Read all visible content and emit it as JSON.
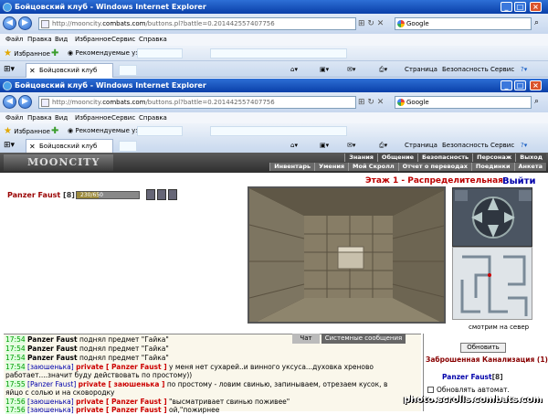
{
  "browser": {
    "title": "Бойцовский клуб - Windows Internet Explorer",
    "url_prefix": "http://mooncity.",
    "url_domain": "combats.com",
    "url_rest": "/buttons.pl?battle=0.201442557407756",
    "search_placeholder": "Google",
    "menu": [
      "Файл",
      "Правка",
      "Вид",
      "Избранное",
      "Сервис",
      "Справка"
    ],
    "favorites_label": "Избранное",
    "suggested_sites": "Рекомендуемые узлы",
    "tab_title": "Бойцовский клуб",
    "commands": {
      "page": "Страница",
      "security": "Безопасность",
      "tools": "Сервис"
    }
  },
  "game": {
    "logo": "MOONCITY",
    "menu_top": [
      "Знания",
      "Общение",
      "Безопасность",
      "Персонаж",
      "Выход"
    ],
    "menu_bottom": [
      "Инвентарь",
      "Умения",
      "Мой Скролл",
      "Отчет о переводах",
      "Поединки",
      "Анкета"
    ],
    "character": {
      "name": "Panzer Faust",
      "level": "[8]",
      "hp": "230/650",
      "hp_fraction": 0.354
    },
    "room_title": "Этаж 1 - Распределительная",
    "exit": "Выйти",
    "look": "смотрим на север",
    "chat_tabs": [
      "Чат",
      "Системные сообщения"
    ],
    "chat": [
      {
        "time": "17:54",
        "who": "Panzer Faust",
        "text": " поднял предмет \"Гайка\""
      },
      {
        "time": "17:54",
        "who": "Panzer Faust",
        "text": " поднял предмет \"Гайка\""
      },
      {
        "time": "17:54",
        "who": "Panzer Faust",
        "text": " поднял предмет \"Гайка\""
      }
    ],
    "chat_private": [
      {
        "time": "17:54",
        "from": "[заюшенька]",
        "priv": "private [ Panzer Faust ]",
        "text": " у меня нет сухарей..и винного уксуса...духовка хреново"
      },
      {
        "cont": "работает....значит буду действовать по простому))"
      },
      {
        "time": "17:55",
        "from": "[Panzer Faust]",
        "priv": "private [ заюшенька ]",
        "text": " по простому - ловим свинью, запинываем, отрезаем кусок, в"
      },
      {
        "cont": "яйцо с солью и на сковородку"
      },
      {
        "time": "17:56",
        "from": "[заюшенька]",
        "priv": "private [ Panzer Faust ]",
        "text": " \"высматривает свинью поживее\""
      },
      {
        "time": "17:56",
        "from": "[заюшенька]",
        "priv": "private [ Panzer Faust ]",
        "text": " ой,\"пожирнее"
      }
    ],
    "side": {
      "refresh": "Обновить",
      "location": "Заброшенная Канализация (1)",
      "player": "Panzer Faust",
      "player_level": "[8]",
      "auto_update": "Обновлять автомат."
    },
    "watermark": "photo.scrolls.combats.com"
  }
}
